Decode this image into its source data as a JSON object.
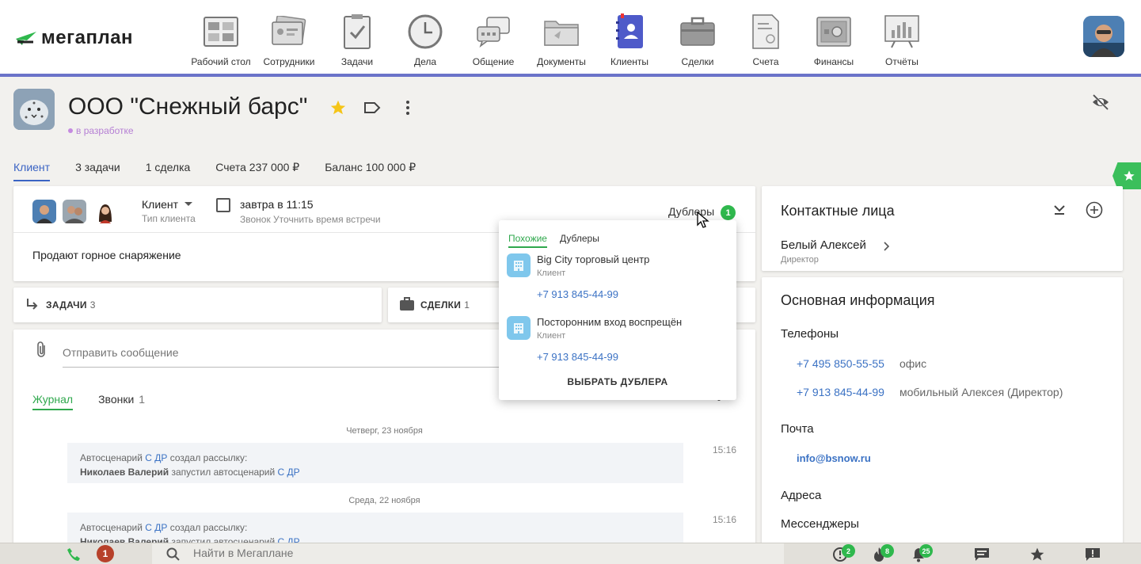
{
  "brand": {
    "name": "мегаплан"
  },
  "nav": {
    "items": [
      {
        "label": "Рабочий стол",
        "icon": "desktop-icon"
      },
      {
        "label": "Сотрудники",
        "icon": "employees-icon"
      },
      {
        "label": "Задачи",
        "icon": "tasks-icon"
      },
      {
        "label": "Дела",
        "icon": "clock-icon"
      },
      {
        "label": "Общение",
        "icon": "chat-icon"
      },
      {
        "label": "Документы",
        "icon": "folder-icon"
      },
      {
        "label": "Клиенты",
        "icon": "contacts-book-icon",
        "active": true
      },
      {
        "label": "Сделки",
        "icon": "briefcase-icon"
      },
      {
        "label": "Счета",
        "icon": "invoice-icon"
      },
      {
        "label": "Финансы",
        "icon": "safe-icon"
      },
      {
        "label": "Отчёты",
        "icon": "reports-icon"
      }
    ],
    "active_color": "#6b73c9"
  },
  "client": {
    "title": "ООО \"Снежный барс\"",
    "status": "в разработке",
    "status_color": "#b57fd4"
  },
  "subtabs": [
    {
      "label": "Клиент",
      "active": true
    },
    {
      "label": "3 задачи"
    },
    {
      "label": "1 сделка"
    },
    {
      "label": "Счета 237 000 ₽"
    },
    {
      "label": "Баланс 100 000 ₽"
    }
  ],
  "main_card": {
    "client_type_value": "Клиент",
    "client_type_caption": "Тип клиента",
    "task_when": "завтра в 11:15",
    "task_desc": "Звонок Уточнить время встречи",
    "duplicates_label": "Дублеры",
    "duplicates_count": "1",
    "description": "Продают горное снаряжение"
  },
  "sections": {
    "tasks_label": "ЗАДАЧИ",
    "tasks_count": "3",
    "deals_label": "СДЕЛКИ",
    "deals_count": "1"
  },
  "feed": {
    "placeholder": "Отправить сообщение",
    "tabs": [
      {
        "label": "Журнал",
        "active": true
      },
      {
        "label": "Звонки",
        "count": "1"
      }
    ],
    "days": [
      {
        "date": "Четверг, 23 ноября",
        "time": "15:16",
        "line1_prefix": "Автосценарий ",
        "line1_link": "С ДР",
        "line1_suffix": " создал рассылку:",
        "line2_user": "Николаев Валерий",
        "line2_mid": " запустил автосценарий ",
        "line2_link": "С ДР"
      },
      {
        "date": "Среда, 22 ноября",
        "time": "15:16",
        "line1_prefix": "Автосценарий ",
        "line1_link": "С ДР",
        "line1_suffix": " создал рассылку:",
        "line2_user": "Николаев Валерий",
        "line2_mid": " запустил автосценарий ",
        "line2_link": "С ДР"
      }
    ]
  },
  "popup": {
    "tabs": [
      {
        "label": "Похожие",
        "active": true
      },
      {
        "label": "Дублеры"
      }
    ],
    "items": [
      {
        "name": "Big City торговый центр",
        "role": "Клиент",
        "phone": "+7 913 845-44-99"
      },
      {
        "name": "Посторонним вход воспрещён",
        "role": "Клиент",
        "phone": "+7 913 845-44-99"
      }
    ],
    "action": "ВЫБРАТЬ ДУБЛЕРА"
  },
  "contacts": {
    "title": "Контактные лица",
    "person_name": "Белый Алексей",
    "person_role": "Директор"
  },
  "info": {
    "title": "Основная информация",
    "phones_heading": "Телефоны",
    "phones": [
      {
        "number": "+7 495 850-55-55",
        "note": "офис"
      },
      {
        "number": "+7 913 845-44-99",
        "note": "мобильный Алексея (Директор)"
      }
    ],
    "mail_heading": "Почта",
    "mail": "info@bsnow.ru",
    "address_heading": "Адреса",
    "messengers_heading": "Мессенджеры"
  },
  "bottom": {
    "missed_calls": "1",
    "search_placeholder": "Найти в Мегаплане",
    "alerts_count": "2",
    "hot_count": "8",
    "notifications_count": "25"
  },
  "colors": {
    "accent_blue": "#3b72c4",
    "accent_green": "#2fb84d"
  }
}
